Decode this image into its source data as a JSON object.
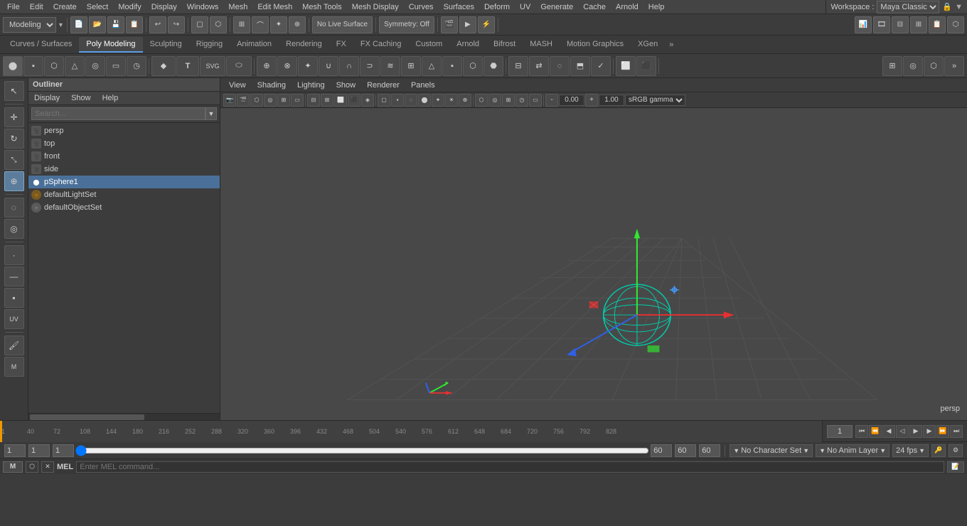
{
  "menubar": {
    "items": [
      "File",
      "Edit",
      "Create",
      "Select",
      "Modify",
      "Display",
      "Windows",
      "Mesh",
      "Edit Mesh",
      "Mesh Tools",
      "Mesh Display",
      "Curves",
      "Surfaces",
      "Deform",
      "UV",
      "Generate",
      "Cache",
      "Arnold",
      "Help"
    ]
  },
  "workspace": {
    "label": "Workspace :",
    "name": "Maya Classic"
  },
  "toolbar": {
    "mode_dropdown": "Modeling",
    "symmetry": "Symmetry: Off",
    "no_live": "No Live Surface"
  },
  "tabs": [
    {
      "label": "Curves / Surfaces",
      "active": false
    },
    {
      "label": "Poly Modeling",
      "active": true
    },
    {
      "label": "Sculpting",
      "active": false
    },
    {
      "label": "Rigging",
      "active": false
    },
    {
      "label": "Animation",
      "active": false
    },
    {
      "label": "Rendering",
      "active": false
    },
    {
      "label": "FX",
      "active": false
    },
    {
      "label": "FX Caching",
      "active": false
    },
    {
      "label": "Custom",
      "active": false
    },
    {
      "label": "Arnold",
      "active": false
    },
    {
      "label": "Bifrost",
      "active": false
    },
    {
      "label": "MASH",
      "active": false
    },
    {
      "label": "Motion Graphics",
      "active": false
    },
    {
      "label": "XGen",
      "active": false
    }
  ],
  "outliner": {
    "title": "Outliner",
    "menus": [
      "Display",
      "Show",
      "Help"
    ],
    "search_placeholder": "Search...",
    "items": [
      {
        "label": "persp",
        "type": "camera",
        "indent": 0
      },
      {
        "label": "top",
        "type": "camera",
        "indent": 0
      },
      {
        "label": "front",
        "type": "camera",
        "indent": 0
      },
      {
        "label": "side",
        "type": "camera",
        "indent": 0
      },
      {
        "label": "pSphere1",
        "type": "sphere",
        "indent": 0,
        "selected": true
      },
      {
        "label": "defaultLightSet",
        "type": "light",
        "indent": 0
      },
      {
        "label": "defaultObjectSet",
        "type": "set",
        "indent": 0
      }
    ]
  },
  "viewport": {
    "menus": [
      "View",
      "Shading",
      "Lighting",
      "Show",
      "Renderer",
      "Panels"
    ],
    "label": "persp",
    "gamma_label": "sRGB gamma",
    "value1": "0.00",
    "value2": "1.00"
  },
  "timeline": {
    "start": "1",
    "end": "60",
    "current": "1",
    "playback_start": "1",
    "playback_end": "60",
    "range_start": "1",
    "range_end": "60",
    "fps": "24 fps",
    "frame_field": "1"
  },
  "status_bar": {
    "field1": "1",
    "field2": "1",
    "field3": "1",
    "no_character_set": "No Character Set",
    "no_anim_layer": "No Anim Layer",
    "fps": "24 fps",
    "range1": "60",
    "range2": "60",
    "range3": "60"
  },
  "bottom_bar": {
    "mel_label": "MEL",
    "script_editor_btn": "»"
  },
  "colors": {
    "accent": "#5c9de8",
    "selected": "#4a7099",
    "bg": "#3c3c3c",
    "toolbar": "#444444",
    "axis_x": "#e83030",
    "axis_y": "#30e830",
    "axis_z": "#3030e8",
    "sphere": "#00ccaa",
    "grid": "#555555"
  }
}
